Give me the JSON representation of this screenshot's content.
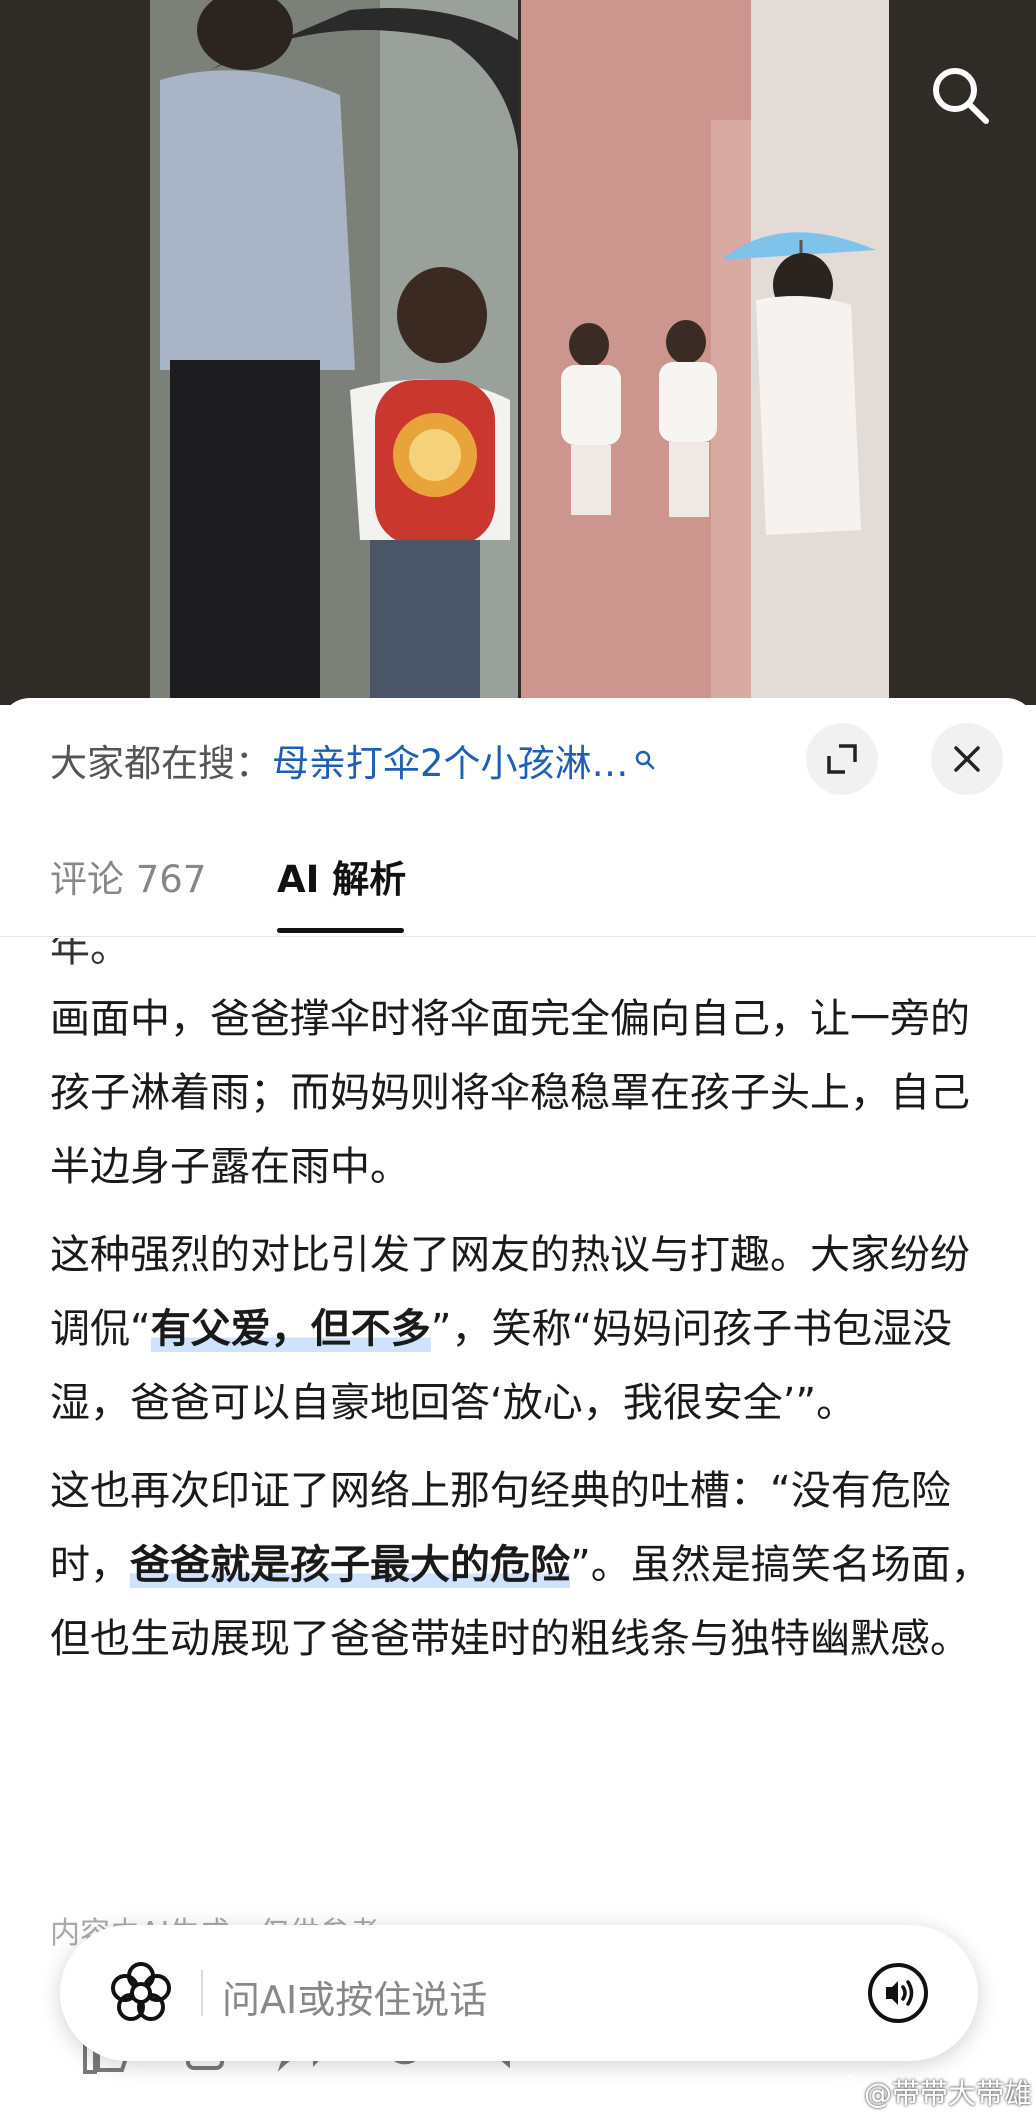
{
  "header": {
    "search_prefix": "大家都在搜：",
    "search_term": "母亲打伞2个小孩淋…",
    "search_term_icon": "magnifier-icon",
    "expand_icon": "expand-icon",
    "close_icon": "close-icon",
    "video_search_icon": "search-icon"
  },
  "tabs": {
    "comments_label": "评论 767",
    "ai_label": "AI 解析"
  },
  "content": {
    "cut_line": "年。",
    "p1": "画面中，爸爸撑伞时将伞面完全偏向自己，让一旁的孩子淋着雨；而妈妈则将伞稳稳罩在孩子头上，自己半边身子露在雨中。",
    "p2_before": "这种强烈的对比引发了网友的热议与打趣。大家纷纷调侃“",
    "p2_highlight": "有父爱，但不多",
    "p2_after": "”，笑称“妈妈问孩子书包湿没湿，爸爸可以自豪地回答‘放心，我很安全’”。",
    "p3_before": "这也再次印证了网络上那句经典的吐槽：“没有危险时，",
    "p3_highlight": "爸爸就是孩子最大的危险",
    "p3_after": "”。虽然是搞笑名场面，但也生动展现了爸爸带娃时的粗线条与独特幽默感。",
    "disclaimer": "内容由AI生成，仅供参考"
  },
  "ask_bar": {
    "placeholder": "问AI或按住说话",
    "logo_icon": "ai-flower-icon",
    "voice_icon": "voice-icon"
  },
  "watermark": "@带带大带雄",
  "colors": {
    "link": "#1f5fb3",
    "highlight": "#cfe2ff"
  }
}
